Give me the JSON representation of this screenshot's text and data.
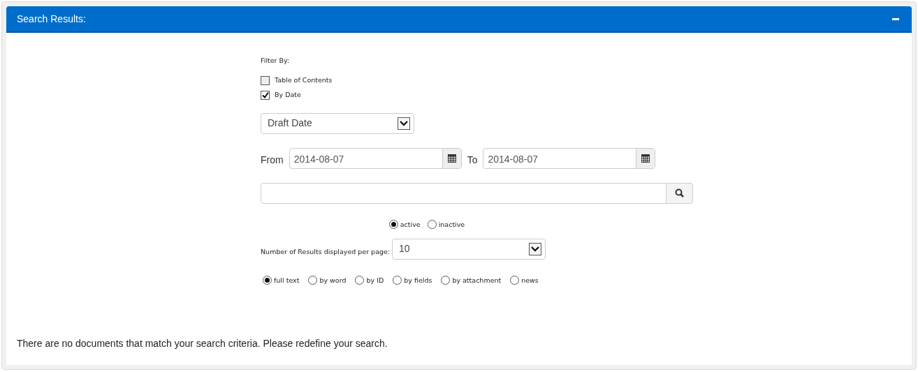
{
  "panel": {
    "title": "Search Results:"
  },
  "filter": {
    "label": "Filter By:",
    "options": [
      {
        "label": "Table of Contents",
        "checked": false
      },
      {
        "label": "By Date",
        "checked": true
      }
    ]
  },
  "date_type": {
    "value": "Draft Date"
  },
  "date_range": {
    "from_label": "From",
    "from_value": "2014-08-07",
    "to_label": "To",
    "to_value": "2014-08-07"
  },
  "status": [
    {
      "label": "active",
      "selected": true
    },
    {
      "label": "inactive",
      "selected": false
    }
  ],
  "per_page": {
    "label": "Number of Results displayed per page:",
    "value": "10"
  },
  "search_type": [
    {
      "label": "full text",
      "selected": true
    },
    {
      "label": "by word",
      "selected": false
    },
    {
      "label": "by ID",
      "selected": false
    },
    {
      "label": "by fields",
      "selected": false
    },
    {
      "label": "by attachment",
      "selected": false
    },
    {
      "label": "news",
      "selected": false
    }
  ],
  "message": "There are no documents that match your search criteria. Please redefine your search."
}
